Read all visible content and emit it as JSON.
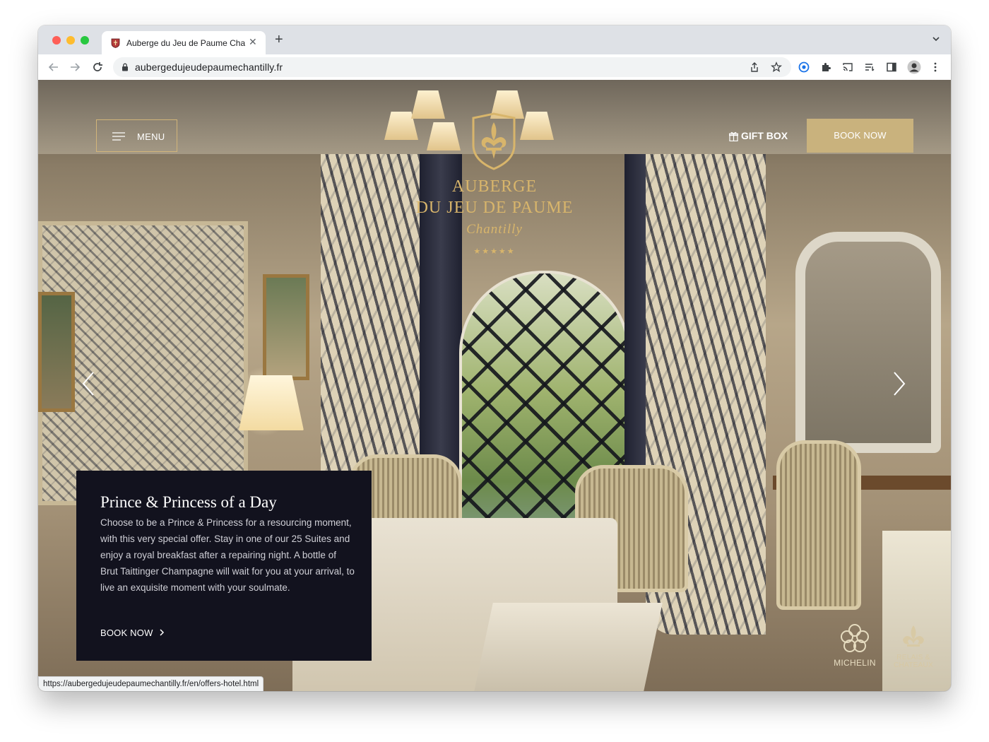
{
  "browser": {
    "tab": {
      "title": "Auberge du Jeu de Paume Cha",
      "close_symbol": "✕"
    },
    "new_tab_symbol": "+",
    "url": "aubergedujeudepaumechantilly.fr",
    "status_url": "https://aubergedujeudepaumechantilly.fr/en/offers-hotel.html",
    "icons": [
      "back-arrow-icon",
      "forward-arrow-icon",
      "reload-icon",
      "lock-icon",
      "share-icon",
      "star-icon",
      "extension-icon",
      "puzzle-icon",
      "cast-icon",
      "reading-list-icon",
      "side-panel-icon",
      "profile-avatar",
      "more-menu-icon"
    ]
  },
  "header": {
    "menu_label": "MENU",
    "gift_label": "GIFT BOX",
    "book_label": "BOOK NOW"
  },
  "logo": {
    "line1": "Auberge",
    "line2": "du Jeu de Paume",
    "line3": "Chantilly",
    "stars": "★★★★★"
  },
  "promo": {
    "title": "Prince & Princess of a Day",
    "body": "Choose to be a Prince & Princess for a resourcing moment, with this very special offer. Stay in one of our 25 Suites and enjoy a royal breakfast after a repairing night. A bottle of Brut Taittinger Champagne will wait for you at your arrival, to live an exquisite moment with your soulmate.",
    "cta": "BOOK NOW"
  },
  "badges": {
    "michelin": "MICHELIN",
    "relais": "RELAIS & CHATEAUX"
  },
  "colors": {
    "gold": "#c9b27d",
    "logo_gold": "#d8b56b",
    "promo_bg": "#12121e"
  }
}
